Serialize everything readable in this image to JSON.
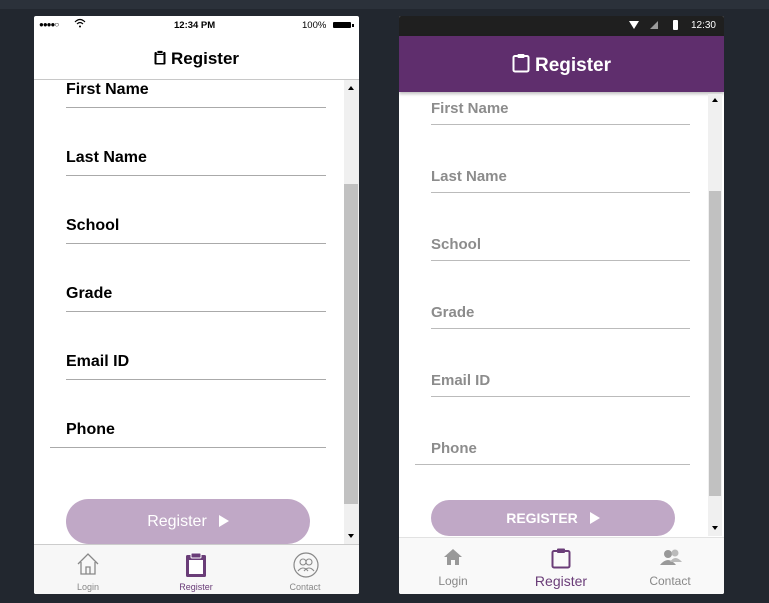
{
  "ios": {
    "status": {
      "signal": "●●●●○",
      "time": "12:34 PM",
      "battery": "100%"
    },
    "title": "Register",
    "fields": [
      {
        "label": "First Name"
      },
      {
        "label": "Last Name"
      },
      {
        "label": "School"
      },
      {
        "label": "Grade"
      },
      {
        "label": "Email ID"
      },
      {
        "label": "Phone"
      }
    ],
    "button": "Register",
    "tabs": [
      {
        "label": "Login",
        "icon": "home-icon"
      },
      {
        "label": "Register",
        "icon": "clipboard-icon",
        "active": true
      },
      {
        "label": "Contact",
        "icon": "contacts-icon"
      }
    ]
  },
  "android": {
    "status": {
      "time": "12:30"
    },
    "title": "Register",
    "fields": [
      {
        "label": "First Name"
      },
      {
        "label": "Last Name"
      },
      {
        "label": "School"
      },
      {
        "label": "Grade"
      },
      {
        "label": "Email ID"
      },
      {
        "label": "Phone"
      }
    ],
    "button": "REGISTER",
    "tabs": [
      {
        "label": "Login",
        "icon": "home-icon"
      },
      {
        "label": "Register",
        "icon": "clipboard-icon",
        "active": true
      },
      {
        "label": "Contact",
        "icon": "contacts-icon"
      }
    ]
  },
  "colors": {
    "background": "#22272f",
    "brand_purple": "#5f2e6d",
    "button_fill": "#c0a8c6",
    "active_tab": "#6a3d78"
  }
}
